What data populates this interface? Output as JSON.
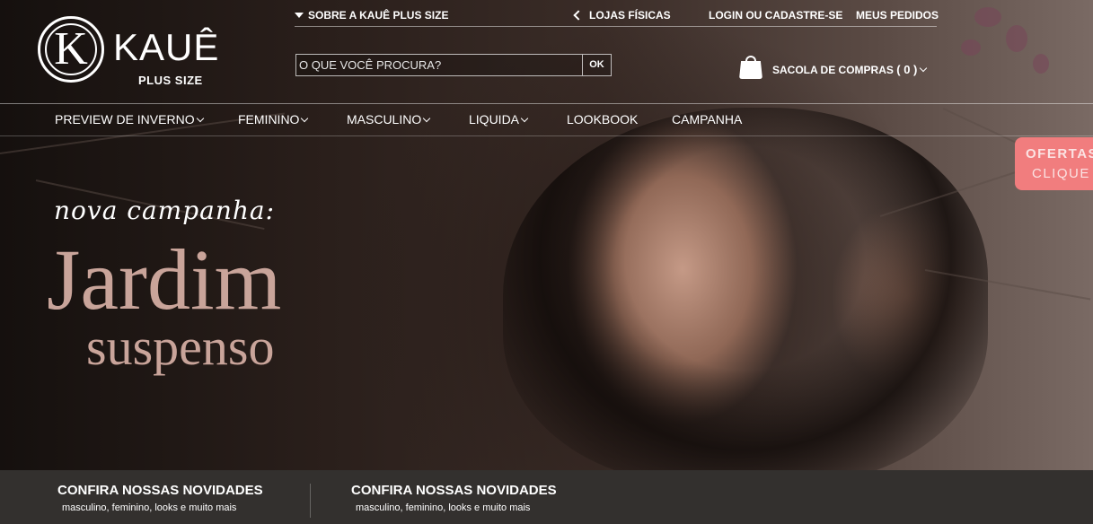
{
  "top_links": {
    "about": "SOBRE A KAUÊ PLUS SIZE",
    "stores": "LOJAS FÍSICAS",
    "login": "LOGIN OU CADASTRE-SE",
    "orders": "MEUS PEDIDOS"
  },
  "logo": {
    "monogram": "K",
    "word": "KAUÊ",
    "sub": "PLUS SIZE"
  },
  "search": {
    "placeholder": "O QUE VOCÊ PROCURA?",
    "button": "OK"
  },
  "cart": {
    "label": "SACOLA DE COMPRAS",
    "count": "( 0 )"
  },
  "main_nav": [
    {
      "label": "PREVIEW DE INVERNO"
    },
    {
      "label": "FEMININO"
    },
    {
      "label": "MASCULINO"
    },
    {
      "label": "LIQUIDA"
    },
    {
      "label": "LOOKBOOK"
    },
    {
      "label": "CAMPANHA"
    }
  ],
  "ofertas": {
    "line1": "OFERTAS",
    "line2": "CLIQUE"
  },
  "campaign": {
    "script": "nova campanha:",
    "title1": "Jardim",
    "title2": "suspenso"
  },
  "promos": [
    {
      "title": "CONFIRA NOSSAS NOVIDADES",
      "subtitle": "masculino, feminino, looks e muito mais"
    },
    {
      "title": "CONFIRA NOSSAS NOVIDADES",
      "subtitle": "masculino, feminino, looks e muito mais"
    }
  ],
  "colors": {
    "accent_title": "#c9a49a",
    "ofertas_bg": "#f17d7e",
    "bottom_bar": "#33302e"
  }
}
